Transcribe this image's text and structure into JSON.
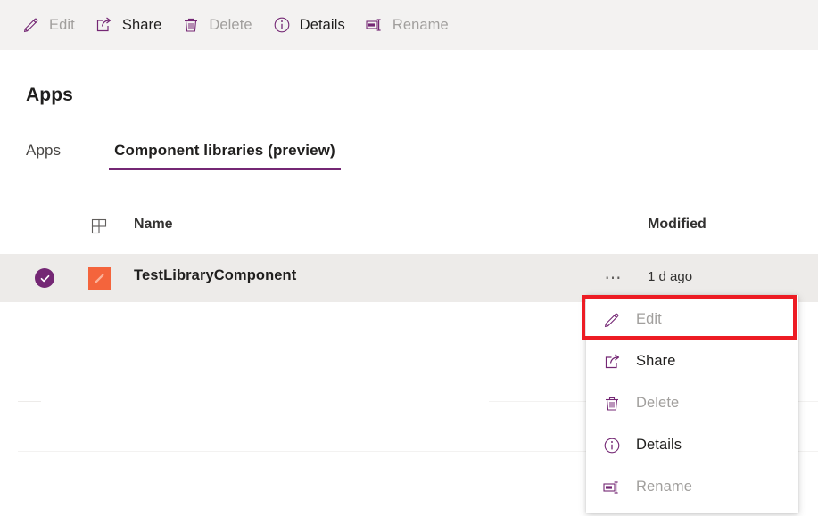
{
  "commandbar": {
    "items": [
      {
        "label": "Edit",
        "icon": "pencil-icon",
        "disabled": true
      },
      {
        "label": "Share",
        "icon": "share-icon",
        "disabled": false
      },
      {
        "label": "Delete",
        "icon": "trash-icon",
        "disabled": true
      },
      {
        "label": "Details",
        "icon": "info-icon",
        "disabled": false
      },
      {
        "label": "Rename",
        "icon": "rename-icon",
        "disabled": true
      }
    ]
  },
  "page": {
    "title": "Apps",
    "tabs": [
      {
        "label": "Apps",
        "active": false
      },
      {
        "label": "Component libraries (preview)",
        "active": true
      }
    ]
  },
  "list": {
    "columns": {
      "icon": "components-grid-icon",
      "name": "Name",
      "modified": "Modified"
    },
    "rows": [
      {
        "selected": true,
        "checkbox_icon": "check-circle-icon",
        "app_icon": "app-pencil-icon",
        "name": "TestLibraryComponent",
        "overflow_icon": "ellipsis-icon",
        "modified": "1 d ago"
      }
    ]
  },
  "context_menu": {
    "items": [
      {
        "label": "Edit",
        "icon": "pencil-icon",
        "disabled": true,
        "highlighted": true
      },
      {
        "label": "Share",
        "icon": "share-icon",
        "disabled": false,
        "highlighted": false
      },
      {
        "label": "Delete",
        "icon": "trash-icon",
        "disabled": true,
        "highlighted": false
      },
      {
        "label": "Details",
        "icon": "info-icon",
        "disabled": false,
        "highlighted": false
      },
      {
        "label": "Rename",
        "icon": "rename-icon",
        "disabled": true,
        "highlighted": false
      }
    ]
  },
  "colors": {
    "accent_purple": "#742774",
    "commandbar_bg": "#f3f2f1",
    "row_selected_bg": "#edebe9",
    "app_icon_orange": "#f4643c",
    "highlight_red": "#ed1c24",
    "disabled_text": "#a19f9d",
    "primary_text": "#201f1e"
  }
}
